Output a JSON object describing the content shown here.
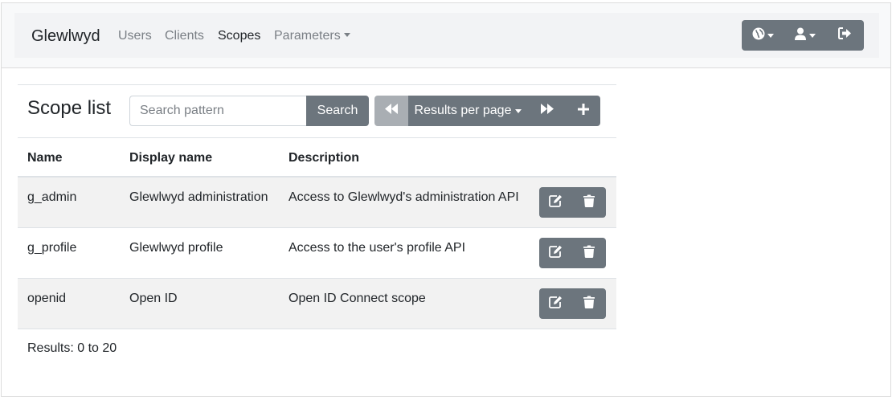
{
  "navbar": {
    "brand": "Glewlwyd",
    "links": [
      "Users",
      "Clients",
      "Scopes",
      "Parameters"
    ],
    "active": "Scopes"
  },
  "scope_list": {
    "title": "Scope list",
    "search_placeholder": "Search pattern",
    "search_label": "Search",
    "results_per_page_label": "Results per page",
    "columns": [
      "Name",
      "Display name",
      "Description"
    ],
    "rows": [
      {
        "name": "g_admin",
        "display_name": "Glewlwyd administration",
        "description": "Access to Glewlwyd's administration API"
      },
      {
        "name": "g_profile",
        "display_name": "Glewlwyd profile",
        "description": "Access to the user's profile API"
      },
      {
        "name": "openid",
        "display_name": "Open ID",
        "description": "Open ID Connect scope"
      }
    ],
    "results_text": "Results: 0 to 20"
  },
  "icons": [
    "globe-icon",
    "user-icon",
    "sign-out-icon",
    "first-page-icon",
    "next-page-icon",
    "plus-icon",
    "edit-icon",
    "trash-icon"
  ],
  "colors": {
    "button": "#6c757d",
    "button_disabled": "#a9aeb3",
    "navbar": "#f8f9fa",
    "stripe": "#f2f2f2"
  }
}
